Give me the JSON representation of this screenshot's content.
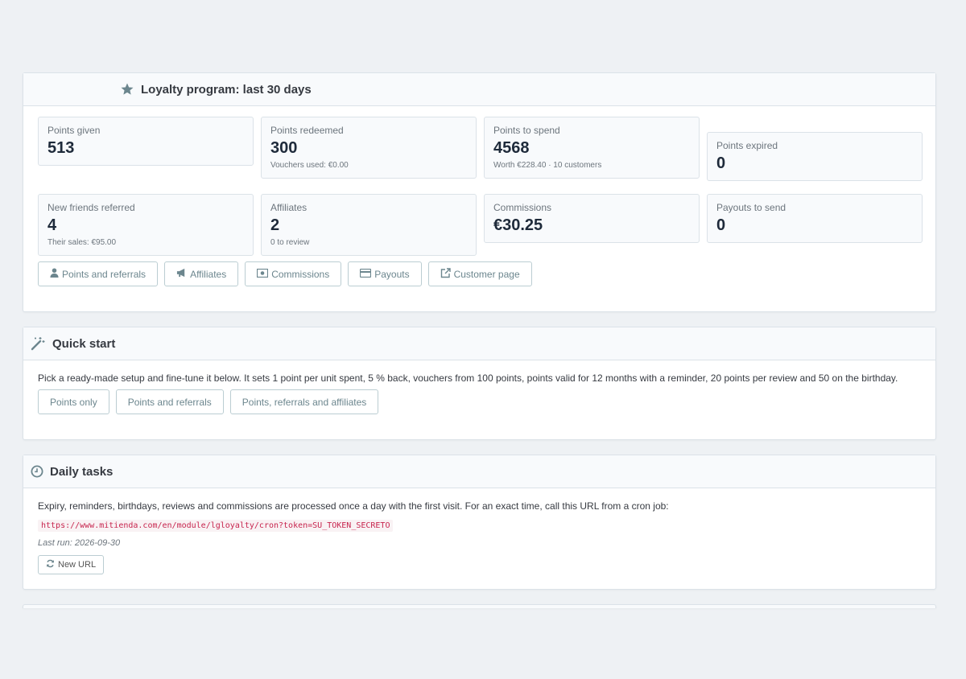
{
  "loyalty": {
    "title": "Loyalty program: last 30 days",
    "icon": "star-icon",
    "stats": [
      {
        "label": "Points given",
        "value": "513",
        "sub": ""
      },
      {
        "label": "Points redeemed",
        "value": "300",
        "sub": "Vouchers used: €0.00"
      },
      {
        "label": "Points to spend",
        "value": "4568",
        "sub": "Worth €228.40 · 10 customers"
      },
      {
        "label": "Points expired",
        "value": "0",
        "sub": ""
      },
      {
        "label": "New friends referred",
        "value": "4",
        "sub": "Their sales: €95.00"
      },
      {
        "label": "Affiliates",
        "value": "2",
        "sub": "0 to review"
      },
      {
        "label": "Commissions",
        "value": "€30.25",
        "sub": ""
      },
      {
        "label": "Payouts to send",
        "value": "0",
        "sub": ""
      }
    ],
    "buttons": [
      {
        "label": "Points and referrals",
        "icon": "user-icon"
      },
      {
        "label": "Affiliates",
        "icon": "megaphone-icon"
      },
      {
        "label": "Commissions",
        "icon": "money-icon"
      },
      {
        "label": "Payouts",
        "icon": "credit-card-icon"
      },
      {
        "label": "Customer page",
        "icon": "external-link-icon"
      }
    ]
  },
  "quickstart": {
    "title": "Quick start",
    "icon": "magic-wand-icon",
    "description": "Pick a ready-made setup and fine-tune it below. It sets 1 point per unit spent, 5 % back, vouchers from 100 points, points valid for 12 months with a reminder, 20 points per review and 50 on the birthday.",
    "buttons": [
      {
        "label": "Points only"
      },
      {
        "label": "Points and referrals"
      },
      {
        "label": "Points, referrals and affiliates"
      }
    ]
  },
  "daily": {
    "title": "Daily tasks",
    "icon": "clock-icon",
    "description": "Expiry, reminders, birthdays, reviews and commissions are processed once a day with the first visit. For an exact time, call this URL from a cron job:",
    "cron_url": "https://www.mitienda.com/en/module/lgloyalty/cron?token=SU_TOKEN_SECRETO",
    "last_run": "Last run: 2026-09-30",
    "new_url_label": "New URL",
    "new_url_icon": "refresh-icon"
  },
  "colors": {
    "background": "#eef1f4",
    "panel_border": "#dbe2e8",
    "heading_bg": "#f8fafc",
    "button_text": "#6c868e",
    "button_border": "#bbcdd2",
    "code_text": "#c7254e"
  }
}
